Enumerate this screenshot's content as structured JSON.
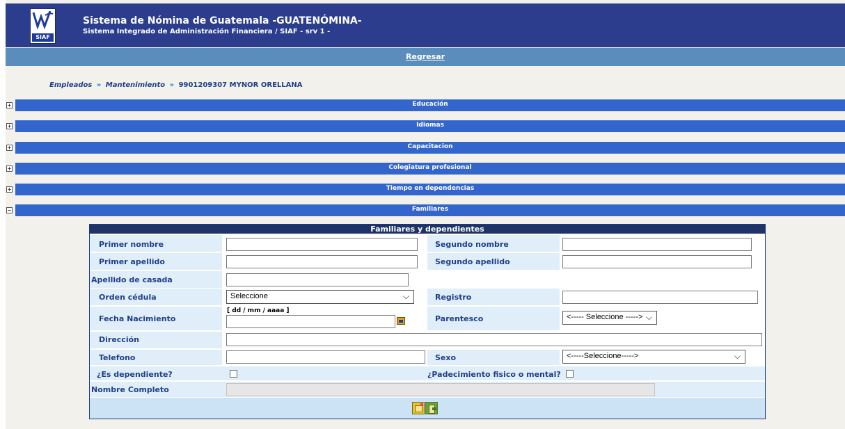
{
  "header": {
    "logo_text": "SIAF",
    "title": "Sistema de Nómina de Guatemala -GUATENÓMINA-",
    "subtitle": "Sistema Integrado de Administración Financiera / SIAF - srv 1 -"
  },
  "nav": {
    "back_label": "Regresar"
  },
  "breadcrumb": {
    "items": [
      "Empleados",
      "Mantenimiento"
    ],
    "separator": "»",
    "current": "9901209307 MYNOR ORELLANA"
  },
  "sections": [
    {
      "label": "Educación",
      "expanded": false,
      "toggle": "+"
    },
    {
      "label": "Idiomas",
      "expanded": false,
      "toggle": "+"
    },
    {
      "label": "Capacitacion",
      "expanded": false,
      "toggle": "+"
    },
    {
      "label": "Colegiatura profesional",
      "expanded": false,
      "toggle": "+"
    },
    {
      "label": "Tiempo en dependencias",
      "expanded": false,
      "toggle": "+"
    },
    {
      "label": "Familiares",
      "expanded": true,
      "toggle": "−"
    }
  ],
  "form": {
    "title": "Familiares y dependientes",
    "primer_nombre": {
      "label": "Primer nombre",
      "value": ""
    },
    "segundo_nombre": {
      "label": "Segundo nombre",
      "value": ""
    },
    "primer_apellido": {
      "label": "Primer apellido",
      "value": ""
    },
    "segundo_apellido": {
      "label": "Segundo apellido",
      "value": ""
    },
    "apellido_casada": {
      "label": "Apellido de casada",
      "value": ""
    },
    "orden_cedula": {
      "label": "Orden cédula",
      "selected": "Seleccione"
    },
    "registro": {
      "label": "Registro",
      "value": ""
    },
    "fecha_nacimiento": {
      "label": "Fecha Nacimiento",
      "format_hint": "[ dd / mm / aaaa ]",
      "value": ""
    },
    "parentesco": {
      "label": "Parentesco",
      "selected": "<----- Seleccione ----->"
    },
    "direccion": {
      "label": "Dirección",
      "value": ""
    },
    "telefono": {
      "label": "Telefono",
      "value": ""
    },
    "sexo": {
      "label": "Sexo",
      "selected": "<-----Seleccione----->"
    },
    "es_dependiente": {
      "label": "¿Es dependiente?",
      "checked": false
    },
    "padecimiento": {
      "label": "¿Padecimiento  fisico o mental?",
      "checked": false
    },
    "nombre_completo": {
      "label": "Nombre Completo",
      "value": ""
    }
  },
  "icons": {
    "calendar": "calendar-icon",
    "new_record": "new-record-icon",
    "exit": "exit-icon",
    "expand": "expand-icon",
    "collapse": "collapse-icon"
  },
  "colors": {
    "header_bg": "#2b3d8c",
    "back_bar_bg": "#5a8cbc",
    "section_bar": "#3366cc",
    "panel_title_bg": "#1e3366",
    "label_text": "#1f3f8a",
    "row_bg": "#e0eefa",
    "page_bg": "#f3f1ec"
  }
}
